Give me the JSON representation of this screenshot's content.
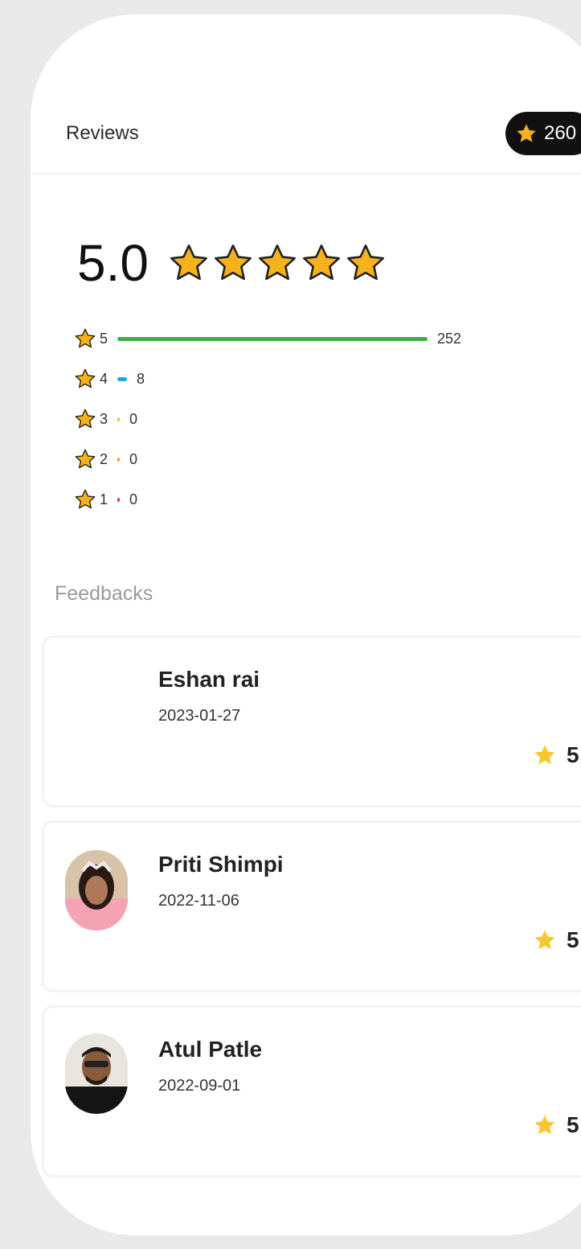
{
  "header": {
    "title": "Reviews",
    "points": "260",
    "points_icon": "star-icon"
  },
  "summary": {
    "average": "5.0",
    "average_stars": 5,
    "star_color": "#f7b21b",
    "distribution": [
      {
        "star": "5",
        "count": "252",
        "fraction": 0.969,
        "color": "#3cb043"
      },
      {
        "star": "4",
        "count": "8",
        "fraction": 0.031,
        "color": "#1aa7ec"
      },
      {
        "star": "3",
        "count": "0",
        "fraction": 0,
        "color": "#f5c518"
      },
      {
        "star": "2",
        "count": "0",
        "fraction": 0,
        "color": "#f5a623"
      },
      {
        "star": "1",
        "count": "0",
        "fraction": 0,
        "color": "#e53935"
      }
    ]
  },
  "feedbacks": {
    "label": "Feedbacks",
    "items": [
      {
        "name": "Eshan rai",
        "date": "2023-01-27",
        "rating": "5",
        "avatar": "none"
      },
      {
        "name": "Priti Shimpi",
        "date": "2022-11-06",
        "rating": "5",
        "avatar": "photo-woman"
      },
      {
        "name": "Atul Patle",
        "date": "2022-09-01",
        "rating": "5",
        "avatar": "photo-man"
      }
    ]
  }
}
